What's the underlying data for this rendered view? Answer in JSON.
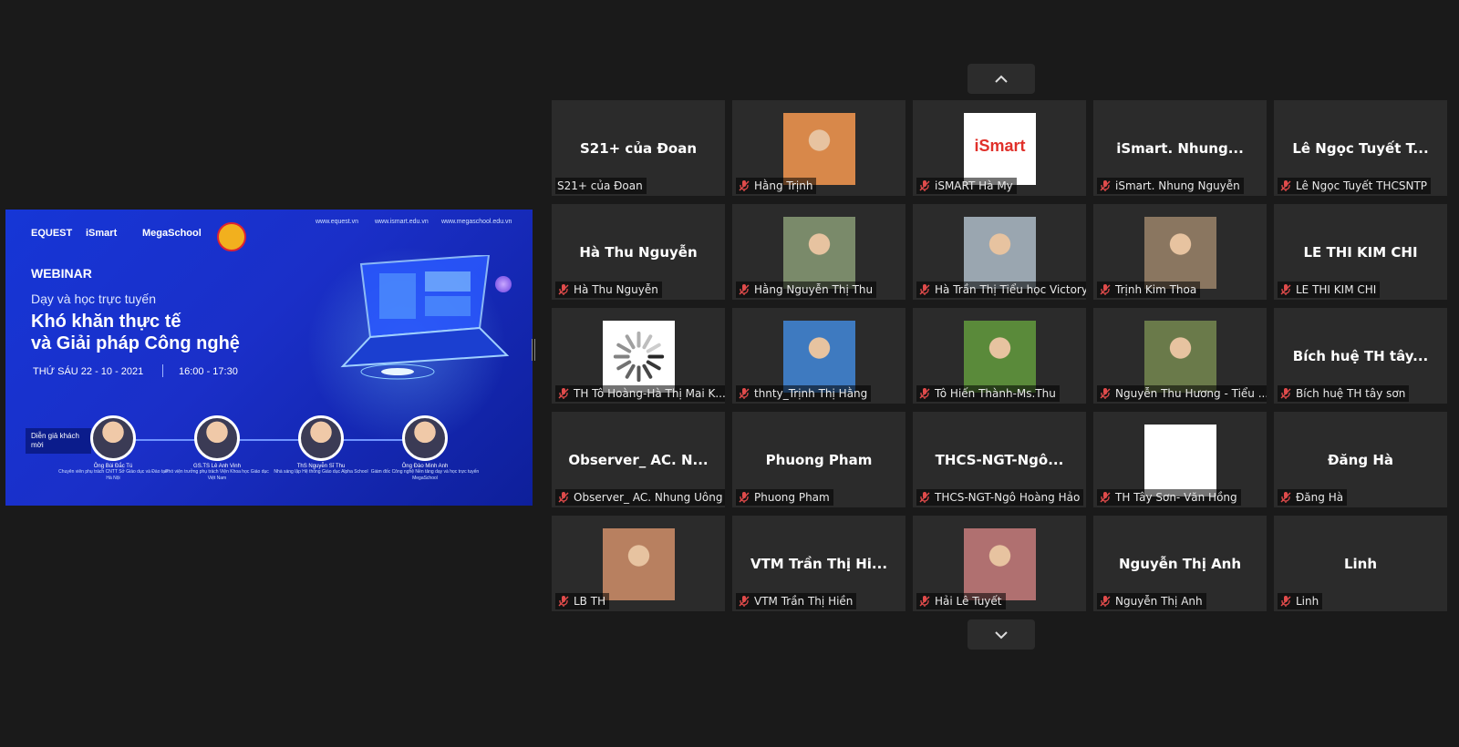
{
  "share": {
    "logos": [
      "EQUEST",
      "iSmart",
      "MegaSchool"
    ],
    "urls": [
      "www.equest.vn",
      "www.ismart.edu.vn",
      "www.megaschool.edu.vn"
    ],
    "tag": "WEBINAR",
    "subtitle": "Dạy và học trực tuyến",
    "headline1": "Khó khăn thực tế",
    "headline2": "và Giải pháp Công nghệ",
    "date": "THỨ SÁU 22 - 10 - 2021",
    "time": "16:00 - 17:30",
    "guest_label": "Diễn giả khách mời",
    "speakers": [
      {
        "name": "Ông Bùi Đắc Tú",
        "role": "Chuyên viên phụ trách CNTT Sở Giáo dục và Đào tạo Hà Nội"
      },
      {
        "name": "GS.TS Lê Anh Vinh",
        "role": "Phó viện trưởng phụ trách Viện Khoa học Giáo dục Việt Nam"
      },
      {
        "name": "ThS Nguyễn Sĩ Thu",
        "role": "Nhà sáng lập Hệ thống Giáo dục Alpha School"
      },
      {
        "name": "Ông Đào Minh Anh",
        "role": "Giám đốc Công nghệ Nền tảng dạy và học trực tuyến MegaSchool"
      }
    ]
  },
  "gallery": {
    "nav_up_icon": "chevron-up-icon",
    "nav_down_icon": "chevron-down-icon",
    "muted_icon": "muted-mic-icon",
    "tiles": [
      {
        "big": "S21+ của Đoan",
        "label": "S21+ của Đoan",
        "muted": false
      },
      {
        "thumb": "photo",
        "color": "#d8884a",
        "label": "Hằng Trịnh",
        "muted": true
      },
      {
        "thumb": "ismart-logo",
        "label": "iSMART Hà My",
        "muted": true
      },
      {
        "big": "iSmart.  Nhung...",
        "label": "iSmart. Nhung Nguyễn",
        "muted": true
      },
      {
        "big": "Lê Ngọc Tuyết T...",
        "label": "Lê Ngọc Tuyết THCSNTP",
        "muted": true
      },
      {
        "big": "Hà Thu Nguyễn",
        "label": "Hà Thu Nguyễn",
        "muted": true
      },
      {
        "thumb": "photo",
        "color": "#7a8a6a",
        "label": "Hằng Nguyễn Thị Thu",
        "muted": true
      },
      {
        "thumb": "photo",
        "color": "#9aa6b0",
        "label": "Hà Trần Thị Tiểu học Victory",
        "muted": true
      },
      {
        "thumb": "photo",
        "color": "#8a7660",
        "label": "Trịnh Kim Thoa",
        "muted": true
      },
      {
        "big": "LE THI KIM CHI",
        "label": "LE THI KIM CHI",
        "muted": true
      },
      {
        "thumb": "loading",
        "label": "TH Tô Hoàng-Hà Thị Mai K...",
        "muted": true
      },
      {
        "thumb": "photo",
        "color": "#3e7ac0",
        "label": "thnty_Trịnh Thị Hằng",
        "muted": true
      },
      {
        "thumb": "photo",
        "color": "#5a8a3a",
        "label": "Tô Hiến Thành-Ms.Thu",
        "muted": true
      },
      {
        "thumb": "photo",
        "color": "#6a7a4a",
        "label": "Nguyễn Thu Hương - Tiểu ...",
        "muted": true
      },
      {
        "big": "Bích huệ TH tây...",
        "label": "Bích huệ TH tây sơn",
        "muted": true
      },
      {
        "big": "Observer_ AC. N...",
        "label": "Observer_ AC. Nhung Uông",
        "muted": true
      },
      {
        "big": "Phuong Pham",
        "label": "Phuong Pham",
        "muted": true
      },
      {
        "big": "THCS-NGT-Ngô...",
        "label": "THCS-NGT-Ngô Hoàng Hảo",
        "muted": true
      },
      {
        "thumb": "blank",
        "label": "TH Tây Sơn- Văn Hồng",
        "muted": true
      },
      {
        "big": "Đăng Hà",
        "label": "Đăng Hà",
        "muted": true
      },
      {
        "thumb": "photo",
        "color": "#b88060",
        "label": "LB TH",
        "muted": true
      },
      {
        "big": "VTM Trần Thị Hi...",
        "label": "VTM Trần Thị Hiền",
        "muted": true
      },
      {
        "thumb": "photo",
        "color": "#b07070",
        "label": "Hải Lê Tuyết",
        "muted": true
      },
      {
        "big": "Nguyễn Thị Anh",
        "label": "Nguyễn Thị Anh",
        "muted": true
      },
      {
        "big": "Linh",
        "label": "Linh",
        "muted": true
      }
    ]
  }
}
